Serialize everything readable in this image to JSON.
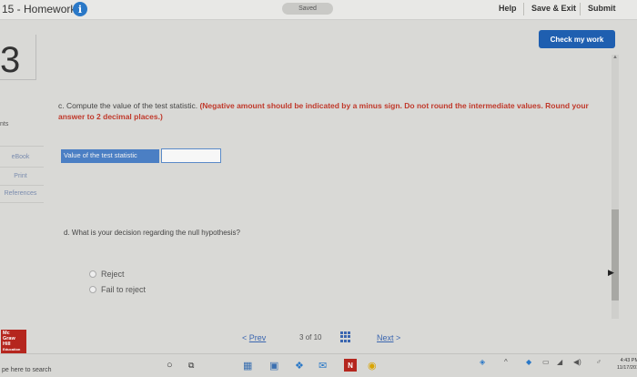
{
  "header": {
    "title": "15 - Homework",
    "saved": "Saved",
    "help": "Help",
    "save_exit": "Save & Exit",
    "submit": "Submit"
  },
  "question": {
    "number": "3",
    "points_label": "nts",
    "check_my_work": "Check my work",
    "part_c_prefix": "c. Compute the value of the test statistic.",
    "part_c_instruction": "(Negative amount should be indicated by a minus sign. Do not round the intermediate values. Round your answer to 2 decimal places.)",
    "stat_label": "Value of the test statistic",
    "stat_value": "",
    "part_d": "d. What is your decision regarding the null hypothesis?",
    "options": [
      "Reject",
      "Fail to reject"
    ]
  },
  "rail": {
    "ebook": "eBook",
    "print": "Print",
    "references": "References"
  },
  "nav": {
    "prev": "Prev",
    "page": "3",
    "of": "of",
    "total": "10",
    "next": "Next"
  },
  "logo": {
    "lines": [
      "Mc",
      "Graw",
      "Hill",
      "Education"
    ]
  },
  "taskbar": {
    "search": "pe here to search",
    "time": "4:43 PM",
    "date": "11/17/201"
  },
  "colors": {
    "accent": "#1f5fb0",
    "instruction_red": "#c0392b",
    "logo_red": "#b5261e"
  }
}
